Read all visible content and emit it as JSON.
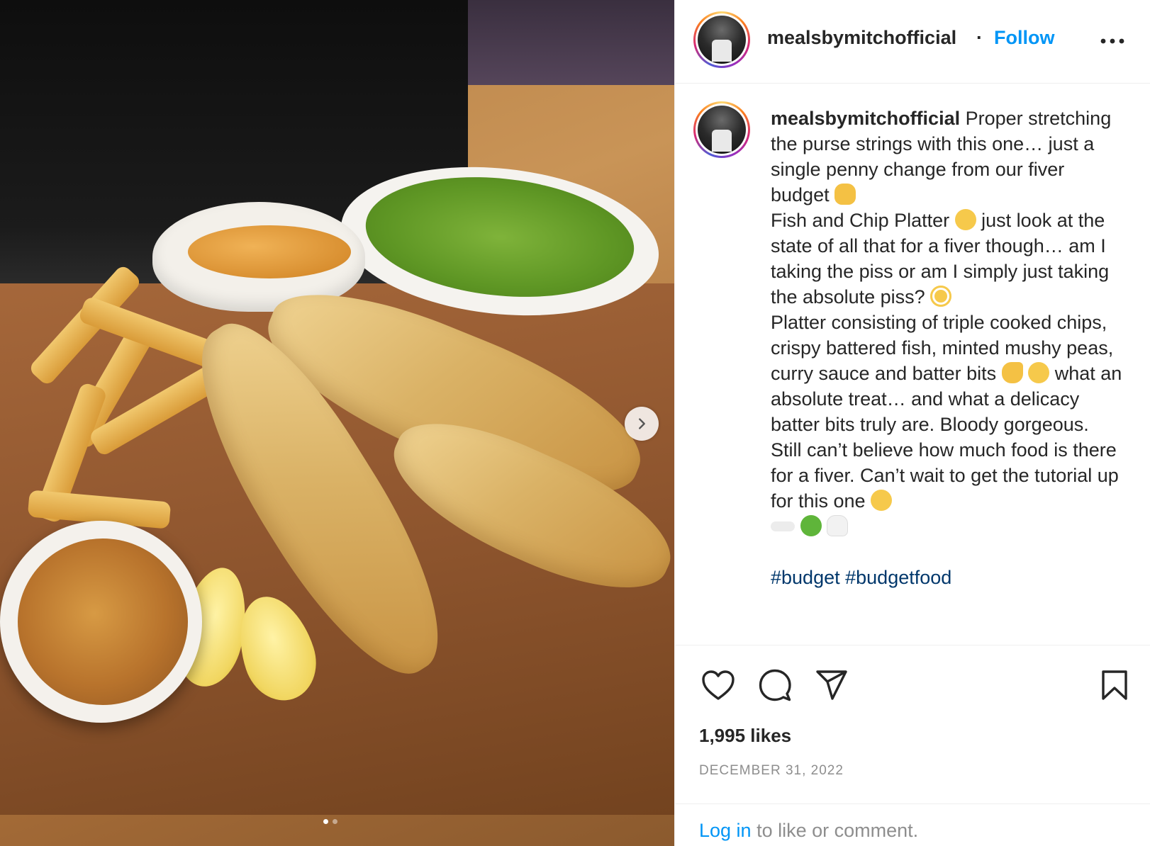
{
  "post": {
    "username": "mealsbymitchofficial",
    "separator": "·",
    "follow_label": "Follow",
    "more_icon": "more-horizontal-icon"
  },
  "caption": {
    "username": "mealsbymitchofficial",
    "line1": "Proper stretching the purse strings with this one… just a single penny change from our fiver budget",
    "line2a": "Fish and Chip Platter",
    "line2b": "just look at the state of all that for a fiver though… am I taking the piss or am I simply just taking the absolute piss?",
    "line3a": "Platter consisting of triple cooked chips, crispy battered fish, minted mushy peas, curry sauce and batter bits",
    "line3b": "what an absolute treat… and what a delicacy batter bits truly are. Bloody gorgeous.",
    "line4": "Still can’t believe how much food is there for a fiver. Can’t wait to get the tutorial up for this one",
    "hashtags": [
      "#budget",
      "#budgetfood"
    ],
    "emojis": [
      "raising-hands",
      "relieved-face",
      "flushed-face",
      "pinching-hand",
      "bone",
      "green-apple",
      "tooth"
    ]
  },
  "actions": {
    "icons": [
      "heart-icon",
      "comment-icon",
      "share-icon",
      "bookmark-icon"
    ]
  },
  "stats": {
    "likes": "1,995 likes",
    "date": "DECEMBER 31, 2022"
  },
  "login": {
    "link": "Log in",
    "rest": " to like or comment."
  },
  "carousel": {
    "slides": 2,
    "current": 1
  },
  "colors": {
    "link_blue": "#0095f6",
    "hashtag_blue": "#00376b",
    "muted": "#8e8e8e",
    "text": "#262626"
  }
}
